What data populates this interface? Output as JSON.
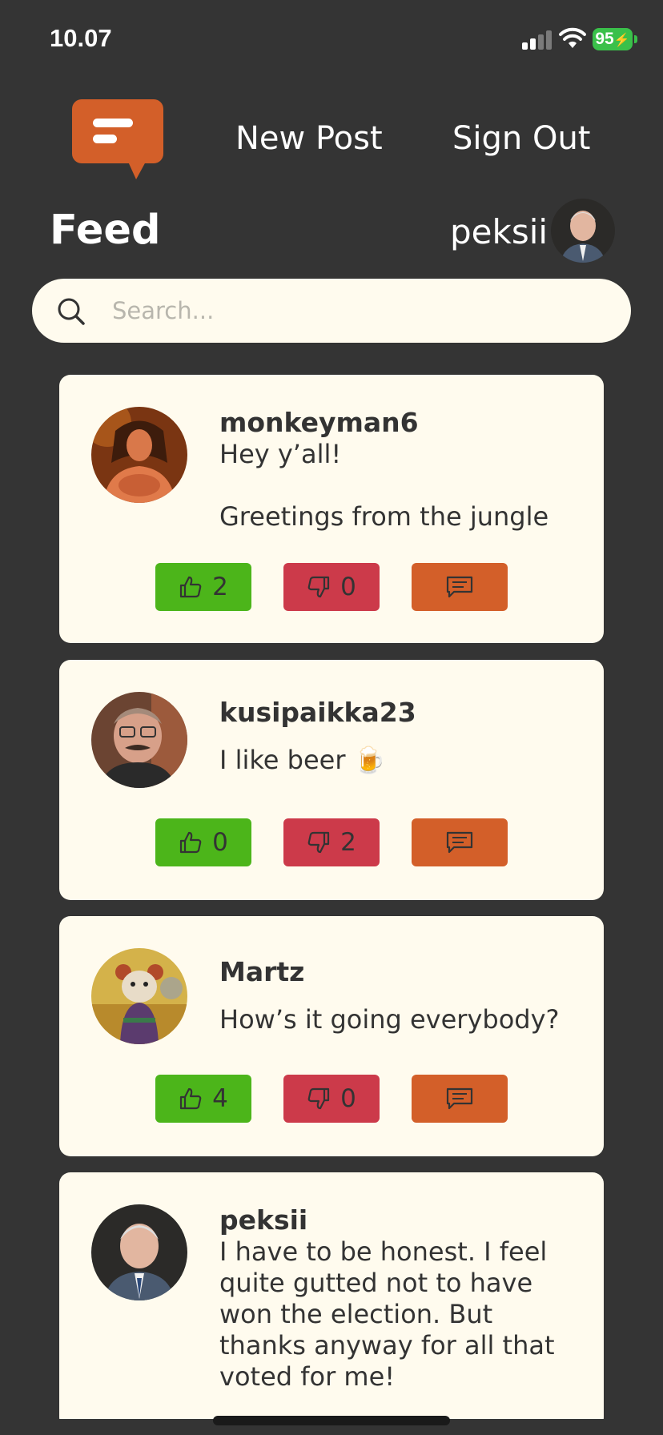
{
  "status_bar": {
    "time": "10.07",
    "battery": "95"
  },
  "header": {
    "logo_icon": "chat-bubble-icon",
    "new_post_label": "New Post",
    "sign_out_label": "Sign Out",
    "page_title": "Feed",
    "current_user": "peksii",
    "brand_color": "#d35f29"
  },
  "search": {
    "placeholder": "Search...",
    "value": ""
  },
  "posts": [
    {
      "author": "monkeyman6",
      "body": "Hey y’all!\n\nGreetings from the jungle",
      "likes": "2",
      "dislikes": "0"
    },
    {
      "author": "kusipaikka23",
      "body": "I like beer 🍺",
      "likes": "0",
      "dislikes": "2"
    },
    {
      "author": "Martz",
      "body": "How’s it going everybody?",
      "likes": "4",
      "dislikes": "0"
    },
    {
      "author": "peksii",
      "body": "I have to be honest. I feel quite gutted not to have won the election. But thanks anyway for all that voted for me!"
    }
  ],
  "colors": {
    "background": "#343434",
    "card": "#fffbee",
    "like": "#4cb51a",
    "dislike": "#cc3a4a",
    "comment": "#d35f29"
  }
}
